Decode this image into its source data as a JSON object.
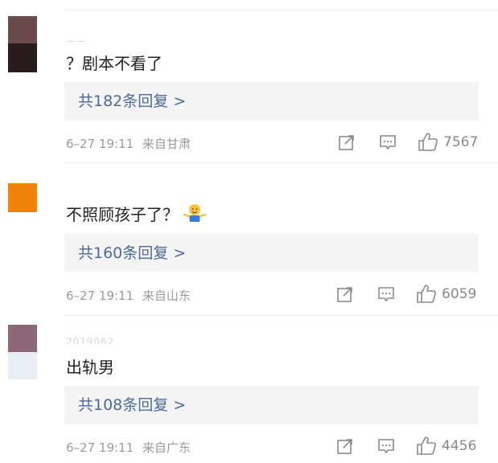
{
  "comments": [
    {
      "username": "——",
      "text": "？剧本不看了",
      "replies": "共182条回复 >",
      "time": "6–27 19:11",
      "location": "来自甘肃",
      "likes": "7567",
      "avatar_colors": [
        "#6a4a4a",
        "#2a1c1a"
      ]
    },
    {
      "username": "",
      "text": "不照顾孩子了？",
      "replies": "共160条回复 >",
      "time": "6–27 19:11",
      "location": "来自山东",
      "likes": "6059",
      "avatar_colors": [
        "#f0820a"
      ]
    },
    {
      "username": "2019062",
      "text": "出轨男",
      "replies": "共108条回复 >",
      "time": "6–27 19:11",
      "location": "来自广东",
      "likes": "4456",
      "avatar_colors": [
        "#8e6878",
        "#e8eef8"
      ]
    }
  ],
  "icons": {
    "share": "share-icon",
    "comment": "comment-icon",
    "like": "thumbs-up-icon",
    "emoji": "shrug-emoji-icon"
  },
  "colors": {
    "reply_link": "#4a6a9a",
    "meta": "#9a9a9a",
    "reply_bg": "#f5f5f5"
  }
}
